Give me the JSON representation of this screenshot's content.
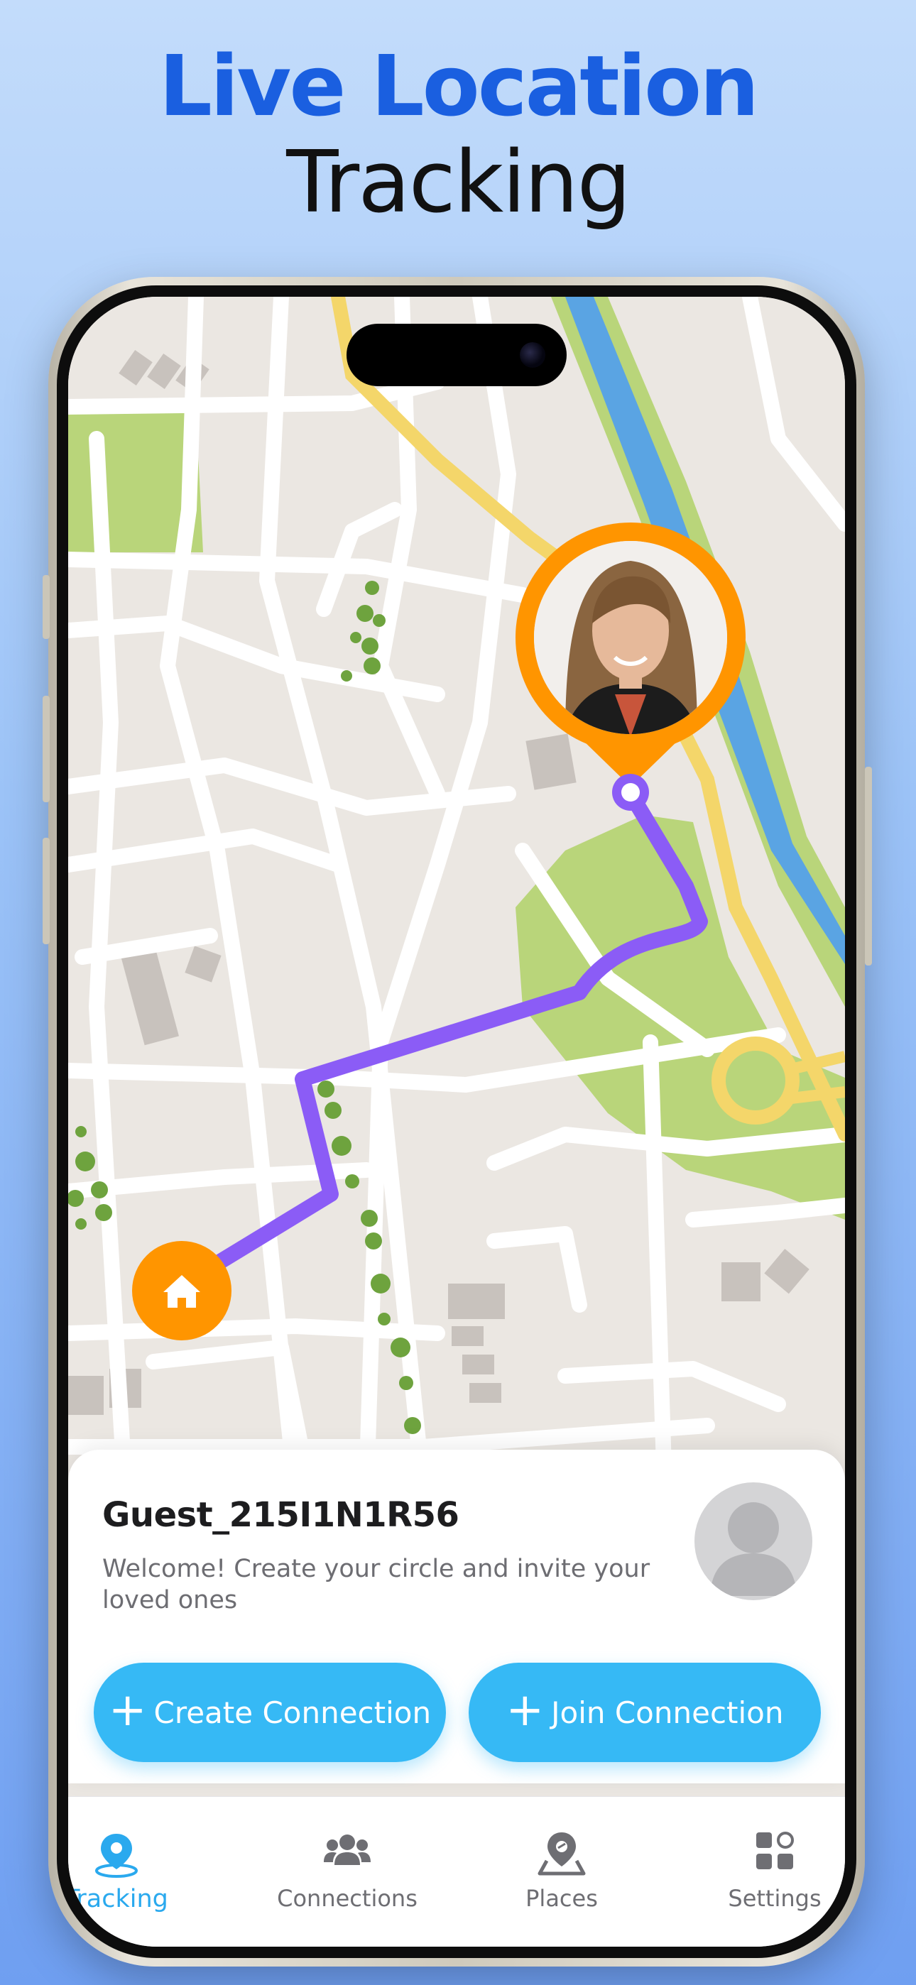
{
  "headline": {
    "line1": "Live Location",
    "line2": "Tracking"
  },
  "map": {
    "person_marker_icon": "user-photo-pin",
    "home_marker_icon": "home-icon",
    "route_color": "#8b5cf6",
    "marker_color": "#ff9500"
  },
  "card": {
    "username": "Guest_215I1N1R56",
    "welcome": "Welcome! Create your circle and invite your loved ones",
    "create_button": "Create Connection",
    "join_button": "Join Connection"
  },
  "tabbar": {
    "active_color": "#2aa9ee",
    "items": [
      {
        "label": "Tracking",
        "icon": "location-pin-icon",
        "active": true
      },
      {
        "label": "Connections",
        "icon": "people-icon",
        "active": false
      },
      {
        "label": "Places",
        "icon": "map-pin-icon",
        "active": false
      },
      {
        "label": "Settings",
        "icon": "grid-icon",
        "active": false
      }
    ]
  }
}
